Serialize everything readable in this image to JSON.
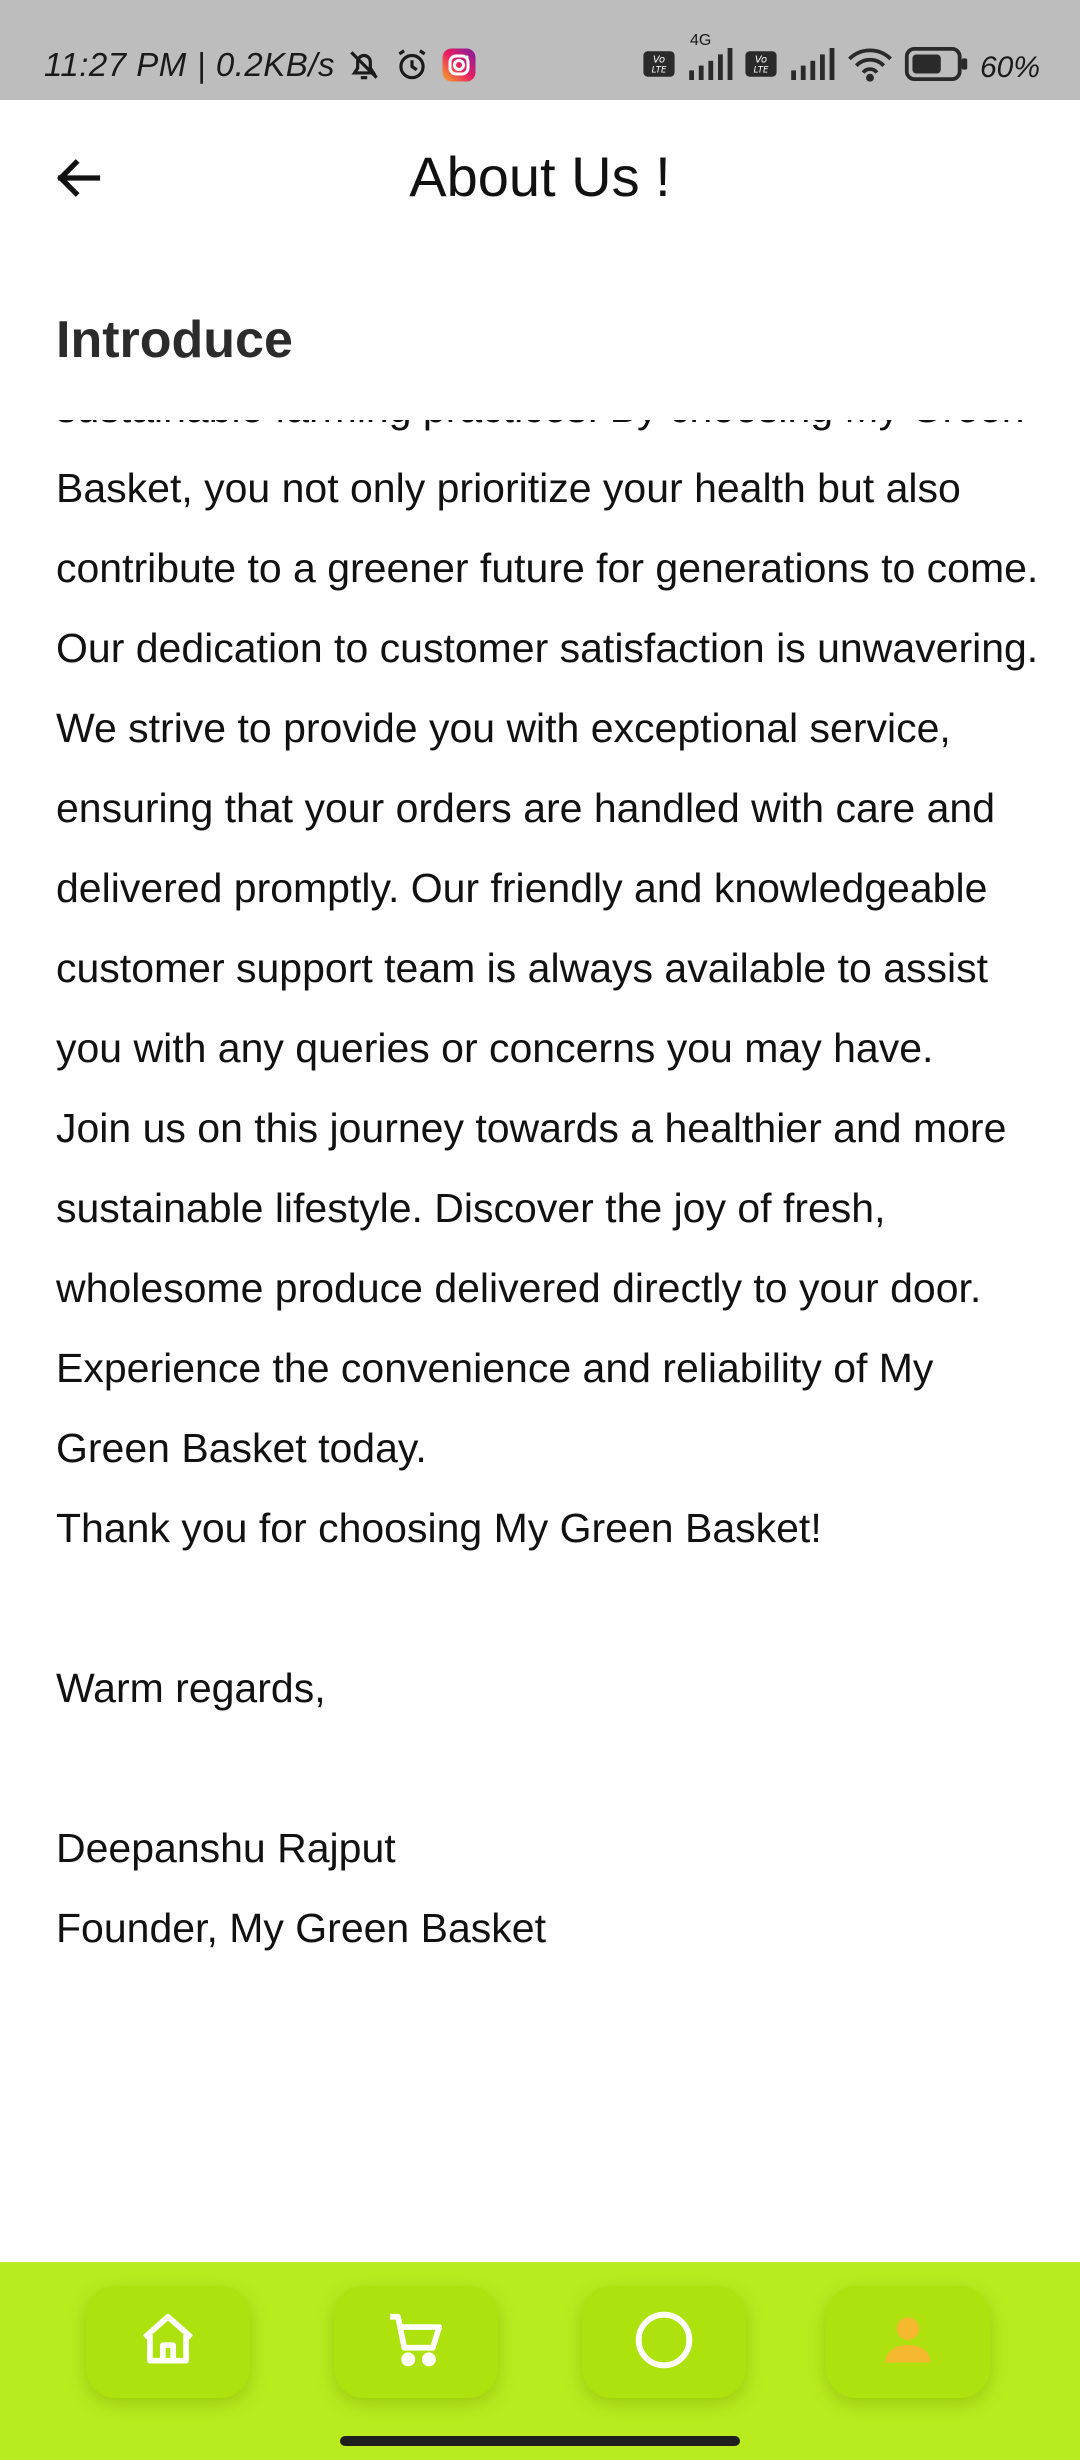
{
  "status_bar": {
    "time": "11:27 PM",
    "separator": "|",
    "net_speed": "0.2KB/s",
    "icons": [
      "mute-icon",
      "alarm-icon",
      "instagram-icon"
    ],
    "network": "4G",
    "right_icons": [
      "volte-icon",
      "signal-icon",
      "volte-icon",
      "signal-icon",
      "wifi-icon",
      "battery-icon"
    ],
    "battery": "60%"
  },
  "app_bar": {
    "back_icon": "arrow-left-icon",
    "title": "About Us !"
  },
  "section": {
    "title": "Introduce",
    "paragraphs": [
      "sustainable farming practices. By choosing My Green Basket, you not only prioritize your health but also contribute to a greener future for generations to come.",
      "Our dedication to customer satisfaction is unwavering. We strive to provide you with exceptional service, ensuring that your orders are handled with care and delivered promptly. Our friendly and knowledgeable customer support team is always available to assist you with any queries or concerns you may have.",
      "Join us on this journey towards a healthier and more sustainable lifestyle. Discover the joy of fresh, wholesome produce delivered directly to your door. Experience the convenience and reliability of My Green Basket today.",
      "Thank you for choosing My Green Basket!"
    ],
    "closing": "Warm regards,",
    "signature_name": "Deepanshu Rajput",
    "signature_role": "Founder, My Green Basket"
  },
  "bottom_nav": {
    "items": [
      {
        "icon": "home-icon"
      },
      {
        "icon": "cart-icon"
      },
      {
        "icon": "circle-icon"
      },
      {
        "icon": "profile-icon"
      }
    ],
    "bar_color": "#b9ec1f",
    "button_color": "#aee20e",
    "active_icon_color": "#f5b82e"
  }
}
